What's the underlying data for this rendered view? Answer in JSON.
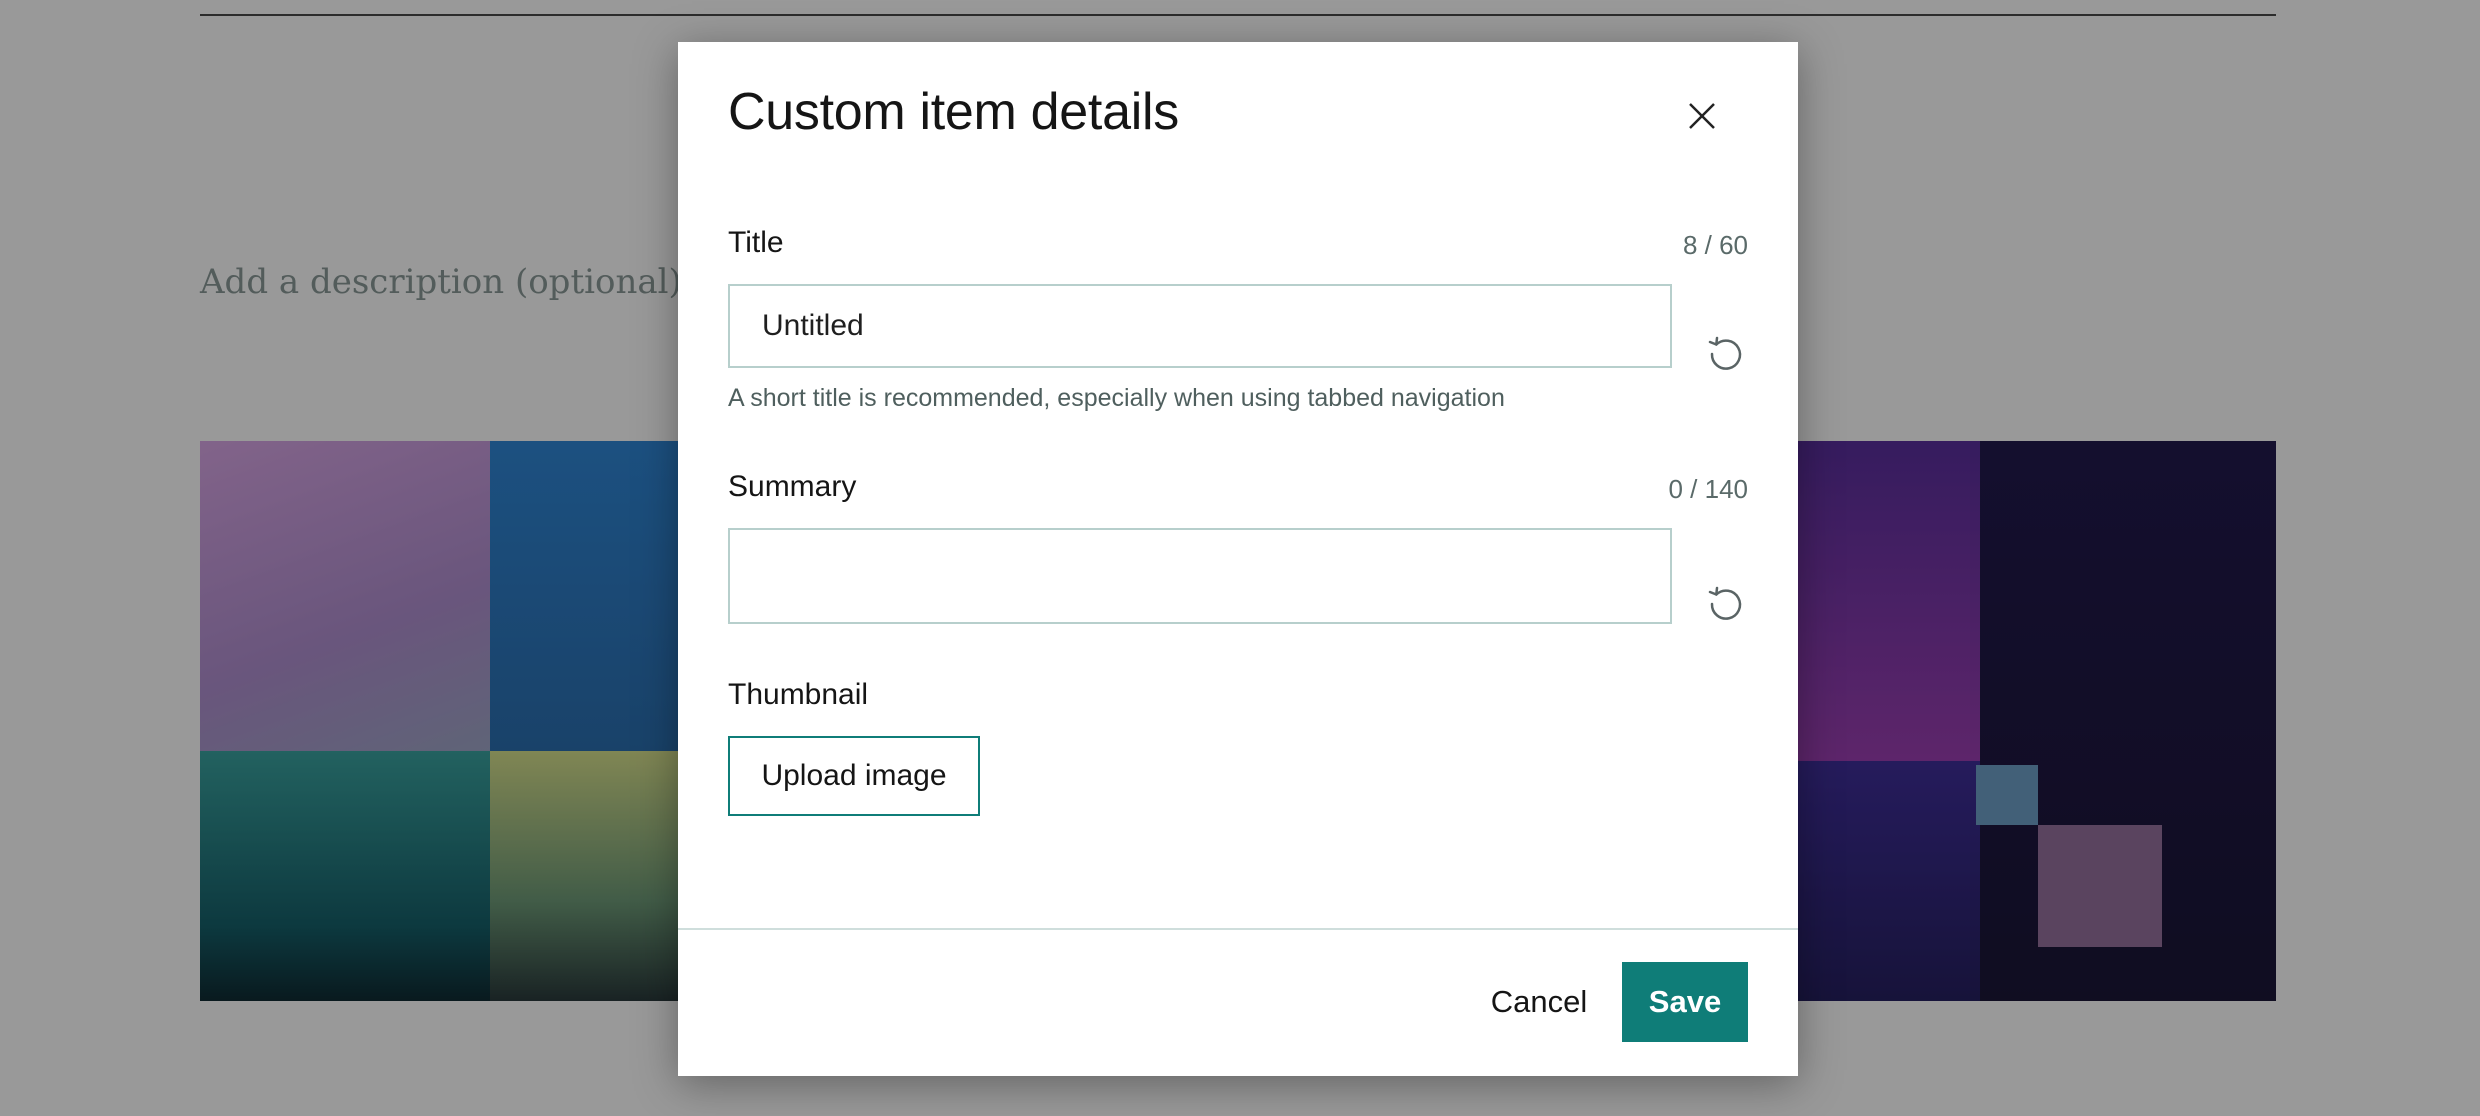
{
  "page": {
    "description_placeholder": "Add a description (optional)"
  },
  "dialog": {
    "title": "Custom item details",
    "close_icon": "close-icon",
    "title_field": {
      "label": "Title",
      "counter": "8 / 60",
      "value": "Untitled",
      "hint": "A short title is recommended, especially when using tabbed navigation",
      "reset_icon": "reset-icon"
    },
    "summary_field": {
      "label": "Summary",
      "counter": "0 / 140",
      "value": "",
      "reset_icon": "reset-icon"
    },
    "thumbnail": {
      "label": "Thumbnail",
      "upload_label": "Upload image"
    },
    "footer": {
      "cancel_label": "Cancel",
      "save_label": "Save"
    }
  },
  "colors": {
    "accent": "#0f7d78",
    "scrim": "rgba(0,0,0,0.40)"
  }
}
